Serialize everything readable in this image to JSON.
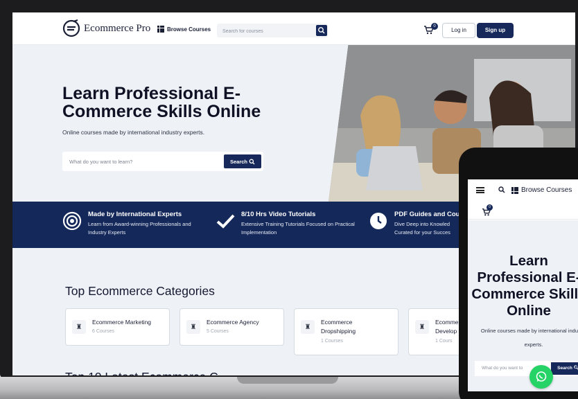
{
  "brand": {
    "name": "Ecommerce Pro"
  },
  "nav": {
    "browse_label": "Browse Courses",
    "search_placeholder": "Search for courses",
    "cart_count": "0",
    "login_label": "Log in",
    "signup_label": "Sign up"
  },
  "hero": {
    "title": "Learn Professional E-Commerce Skills Online",
    "subtitle": "Online courses made by international industry experts.",
    "search_placeholder": "What do you want to learn?",
    "search_button": "Search"
  },
  "features": [
    {
      "title": "Made by International Experts",
      "desc": "Learn from Award-winning Professionals and Industry Experts",
      "icon": "target-icon"
    },
    {
      "title": "8/10 Hrs Video Tutorials",
      "desc": "Extensive Training Tutorials Focused on Practical Implementation",
      "icon": "checkmark-icon"
    },
    {
      "title": "PDF Guides and Cou",
      "desc": "Dive Deep into Knowled Curated for your Succes",
      "icon": "clock-icon"
    }
  ],
  "categories": {
    "title": "Top Ecommerce Categories",
    "items": [
      {
        "name": "Ecommerce Marketing",
        "count": "6 Courses"
      },
      {
        "name": "Ecommerce Agency",
        "count": "5 Courses"
      },
      {
        "name": "Ecommerce Dropshipping",
        "count": "1 Courses"
      },
      {
        "name": "Ecomme Develop",
        "count": "1 Cours"
      }
    ],
    "next_section_title": "Top 10 Latest Ecommerce C"
  },
  "phone": {
    "browse_label": "Browse Courses",
    "cart_count": "0",
    "title": "Learn Professional E-Commerce Skills Online",
    "subtitle": "Online courses made by international industry experts.",
    "search_placeholder": "What do you want to",
    "search_button": "Search"
  },
  "colors": {
    "navy": "#16295a",
    "whatsapp": "#25d366"
  }
}
